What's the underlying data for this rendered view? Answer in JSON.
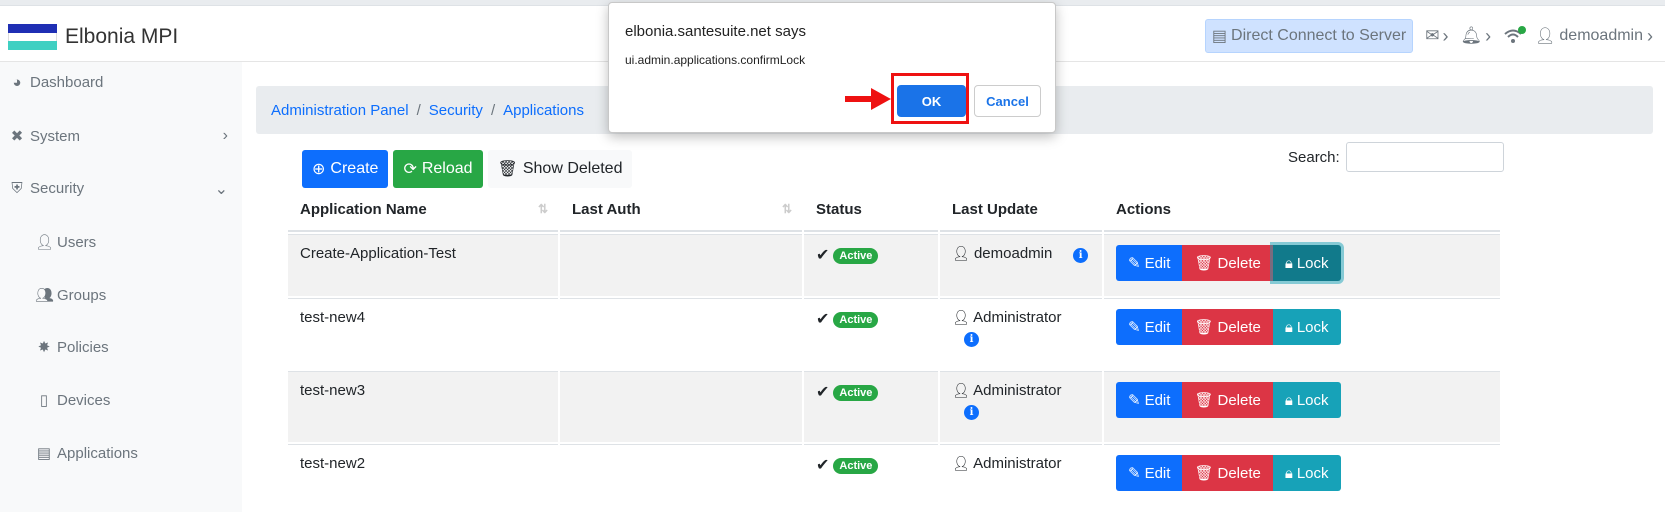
{
  "brand": {
    "name": "Elbonia MPI"
  },
  "navbar": {
    "direct_connect": "Direct Connect to Server",
    "user": "demoadmin"
  },
  "sidebar": {
    "items": [
      {
        "label": "Dashboard",
        "icon": "dashboard-icon"
      },
      {
        "label": "System",
        "icon": "tools-icon"
      },
      {
        "label": "Security",
        "icon": "shield-icon"
      },
      {
        "label": "Users",
        "icon": "user-icon"
      },
      {
        "label": "Groups",
        "icon": "users-icon"
      },
      {
        "label": "Policies",
        "icon": "certificate-icon"
      },
      {
        "label": "Devices",
        "icon": "tablet-icon"
      },
      {
        "label": "Applications",
        "icon": "window-icon"
      }
    ]
  },
  "breadcrumb": [
    "Administration Panel",
    "Security",
    "Applications"
  ],
  "toolbar": {
    "create": "Create",
    "reload": "Reload",
    "show_deleted": "Show Deleted"
  },
  "search": {
    "label": "Search:",
    "value": ""
  },
  "table": {
    "headers": [
      "Application Name",
      "Last Auth",
      "Status",
      "Last Update",
      "Actions"
    ],
    "rows": [
      {
        "name": "Create-Application-Test",
        "last_auth": "",
        "status": "Active",
        "updated_by": "demoadmin"
      },
      {
        "name": "test-new4",
        "last_auth": "",
        "status": "Active",
        "updated_by": "Administrator"
      },
      {
        "name": "test-new3",
        "last_auth": "",
        "status": "Active",
        "updated_by": "Administrator"
      },
      {
        "name": "test-new2",
        "last_auth": "",
        "status": "Active",
        "updated_by": "Administrator"
      }
    ],
    "actions": {
      "edit": "Edit",
      "delete": "Delete",
      "lock": "Lock"
    }
  },
  "dialog": {
    "title": "elbonia.santesuite.net says",
    "message": "ui.admin.applications.confirmLock",
    "ok": "OK",
    "cancel": "Cancel"
  },
  "colors": {
    "primary": "#0d6efd",
    "success": "#28a745",
    "danger": "#dc3545",
    "info": "#17a2b8",
    "highlight": "#ee1111"
  }
}
